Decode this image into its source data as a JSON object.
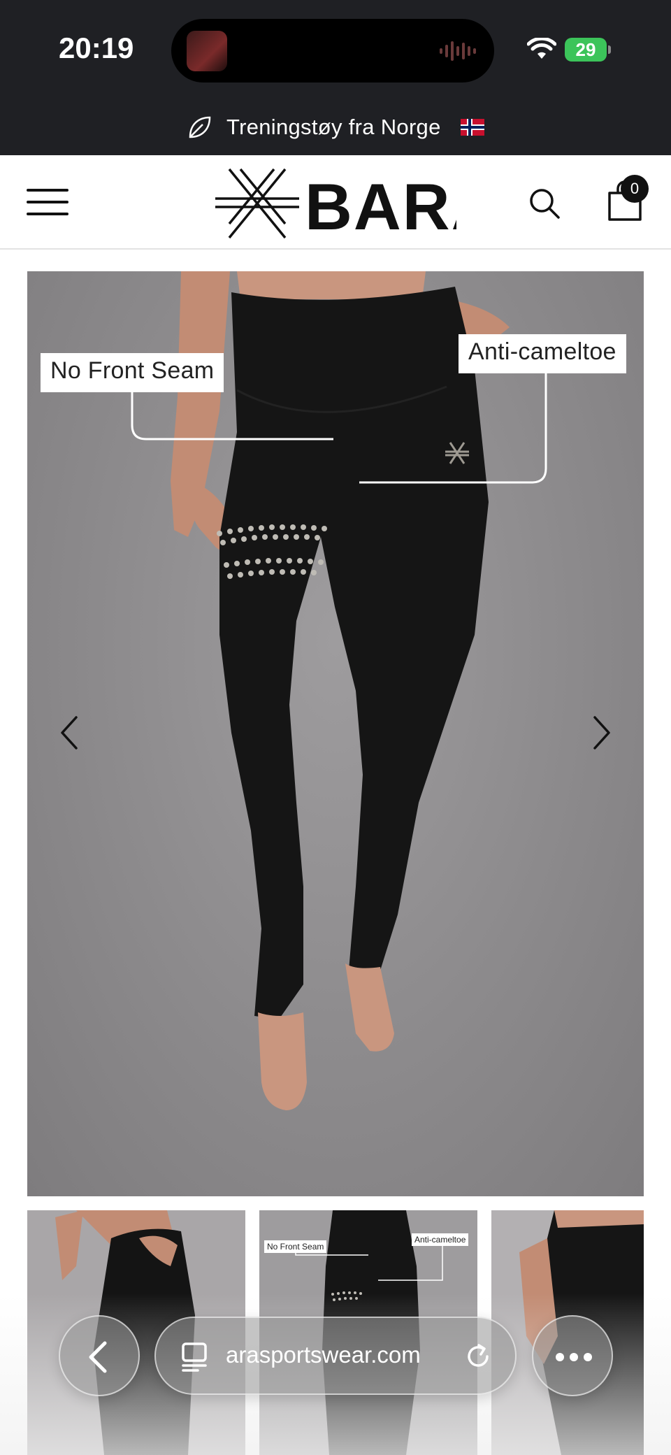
{
  "status_bar": {
    "time": "20:19",
    "battery": "29"
  },
  "announcement": {
    "text": "Treningstøy fra Norge",
    "icon": "leaf-icon",
    "flag": "norway-flag"
  },
  "header": {
    "logo_text": "BARA",
    "cart_count": "0",
    "icons": [
      "menu-icon",
      "search-icon",
      "shopping-bag-icon"
    ]
  },
  "product_gallery": {
    "main_image": {
      "alt": "Black seamless leggings with dotted thigh band",
      "labels": {
        "front": "No Front Seam",
        "anti": "Anti-cameltoe"
      }
    },
    "thumbnails": [
      {
        "alt": "Leggings side view"
      },
      {
        "alt": "Leggings front view with labels",
        "labels": {
          "front": "No Front Seam",
          "anti": "Anti-cameltoe"
        }
      },
      {
        "alt": "Leggings back view"
      }
    ]
  },
  "browser": {
    "url": "barasportswear.com",
    "url_visible": "arasportswear.com"
  },
  "colors": {
    "dark_bar": "#1f2024",
    "battery_green": "#3cc45a",
    "legging_black": "#141414"
  }
}
